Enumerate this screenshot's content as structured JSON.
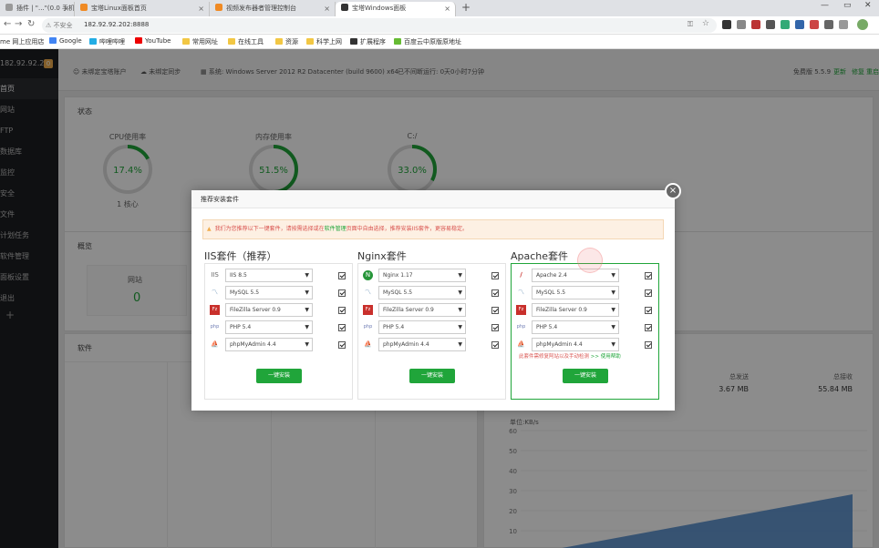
{
  "browser": {
    "tabs": [
      {
        "label": "插件 | \"...\"(0.0 手机...站)"
      },
      {
        "label": "宝塔Linux面板首页"
      },
      {
        "label": "视频发布器者管理控制台"
      },
      {
        "label": "宝塔Windows面板"
      }
    ],
    "active_tab": 3,
    "address": {
      "security": "不安全",
      "url": "182.92.92.202:8888"
    },
    "bookmarks": [
      "me 网上应用店",
      "Google",
      "哔哩哔哩",
      "YouTube",
      "常用网址",
      "在线工具",
      "资源",
      "科学上网",
      "扩展程序",
      "百度云中原版原地址"
    ]
  },
  "sidebar": {
    "ip": "182.92.92.202",
    "badge": "0",
    "items": [
      {
        "label": "首页"
      },
      {
        "label": "网站"
      },
      {
        "label": "FTP"
      },
      {
        "label": "数据库"
      },
      {
        "label": "监控"
      },
      {
        "label": "安全"
      },
      {
        "label": "文件"
      },
      {
        "label": "计划任务"
      },
      {
        "label": "软件管理"
      },
      {
        "label": "面板设置"
      },
      {
        "label": "退出"
      }
    ],
    "add": "+"
  },
  "topbar": {
    "bind_account": "未绑定宝塔账户",
    "sync": "未绑定同步",
    "system_label": "系统:",
    "system": "Windows Server 2012 R2 Datacenter (build 9600) x64",
    "uptime": "已不间断运行: 0天0小时7分钟",
    "version_label": "免费版 5.5.9",
    "update": "更新",
    "repair": "修复",
    "restart": "重启"
  },
  "status": {
    "title": "状态",
    "gauges": [
      {
        "label": "CPU使用率",
        "value": "17.4%",
        "percent": 17.4,
        "sub": "1 核心"
      },
      {
        "label": "内存使用率",
        "value": "51.5%",
        "percent": 51.5,
        "sub": ""
      },
      {
        "label": "C:/",
        "value": "33.0%",
        "percent": 33.0,
        "sub": ""
      }
    ]
  },
  "overview": {
    "title": "概览",
    "site_label": "网站",
    "site_value": "0"
  },
  "software": {
    "title": "软件"
  },
  "traffic": {
    "sent_label": "总发送",
    "sent_value": "3.67 MB",
    "recv_label": "总接收",
    "recv_value": "55.84 MB",
    "unit": "单位:KB/s",
    "ticks": [
      "60",
      "50",
      "40",
      "30",
      "20",
      "10"
    ]
  },
  "modal": {
    "title": "推荐安装套件",
    "close": "×",
    "alert_prefix": "我们为您推荐以下一键套件，请按需选择或在",
    "alert_link": "软件管理",
    "alert_suffix": "页面中自由选择，推荐安装IIS套件，更容易稳定。",
    "suites": [
      {
        "title": "IIS套件（推荐）",
        "rows": [
          {
            "icon": "IIS",
            "value": "IIS 8.5"
          },
          {
            "icon": "〽",
            "value": "MySQL 5.5"
          },
          {
            "icon": "Fz",
            "value": "FileZilla Server 0.9"
          },
          {
            "icon": "php",
            "value": "PHP 5.4"
          },
          {
            "icon": "⛵",
            "value": "phpMyAdmin 4.4"
          }
        ],
        "button": "一键安装"
      },
      {
        "title": "Nginx套件",
        "rows": [
          {
            "icon": "N",
            "value": "Nginx 1.17"
          },
          {
            "icon": "〽",
            "value": "MySQL 5.5"
          },
          {
            "icon": "Fz",
            "value": "FileZilla Server 0.9"
          },
          {
            "icon": "php",
            "value": "PHP 5.4"
          },
          {
            "icon": "⛵",
            "value": "phpMyAdmin 4.4"
          }
        ],
        "button": "一键安装"
      },
      {
        "title": "Apache套件",
        "rows": [
          {
            "icon": "∕",
            "value": "Apache 2.4"
          },
          {
            "icon": "〽",
            "value": "MySQL 5.5"
          },
          {
            "icon": "Fz",
            "value": "FileZilla Server 0.9"
          },
          {
            "icon": "php",
            "value": "PHP 5.4"
          },
          {
            "icon": "⛵",
            "value": "phpMyAdmin 4.4"
          }
        ],
        "note": "此套件需修复阿站以及手动检测",
        "note_link": ">> 使用帮助",
        "button": "一键安装"
      }
    ]
  },
  "colors": {
    "accent": "#20a53a",
    "warning": "#f0ad4e",
    "danger": "#d9534f",
    "sidebar": "#1d1e22"
  }
}
